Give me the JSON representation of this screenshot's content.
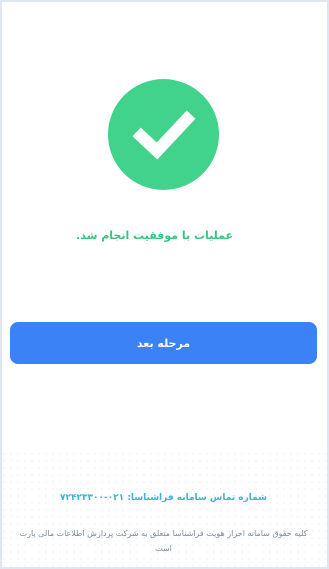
{
  "status": {
    "icon": "checkmark-icon",
    "color": "#41d38b",
    "message": "عملیات با موفقیت انجام شد."
  },
  "actions": {
    "next_label": "مرحله بعد",
    "button_color": "#3b82f6"
  },
  "footer": {
    "contact_label": "شماره تماس سامانه فراشناسا:",
    "contact_number": "۰۲۱-۷۲۴۲۳۳۰۰",
    "copyright": "کلیه حقوق سامانه احراز هویت فراشناسا متعلق به شرکت پردازش اطلاعات مالی پارت است"
  }
}
